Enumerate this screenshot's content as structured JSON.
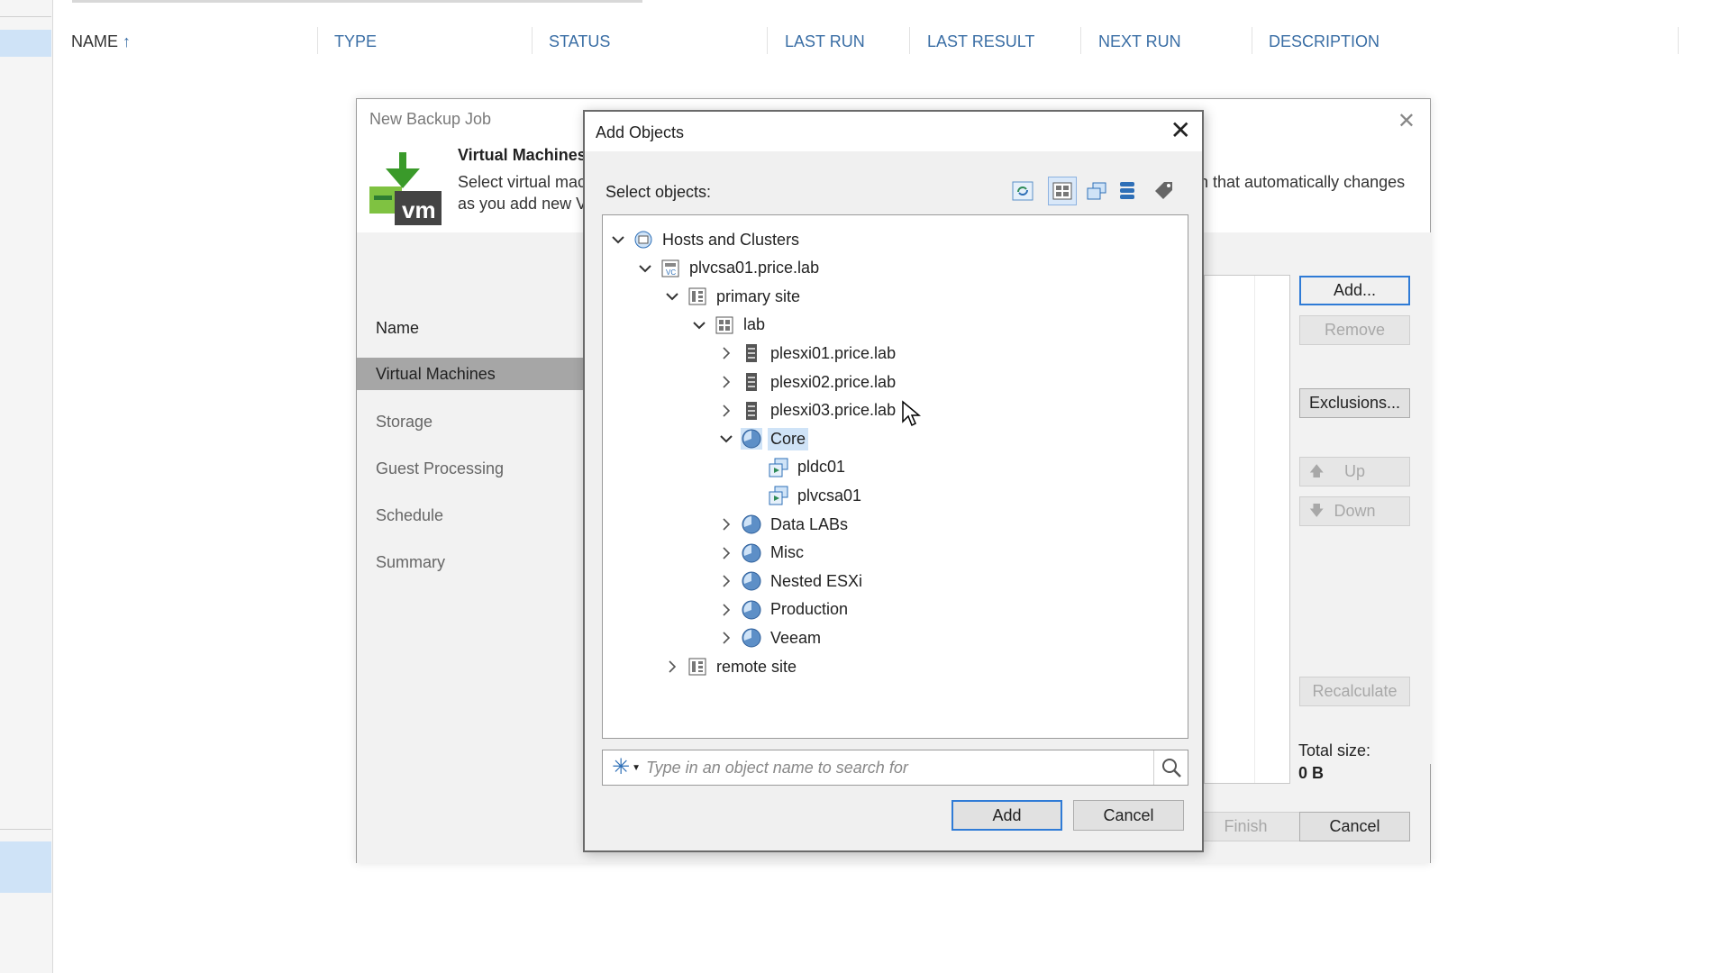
{
  "background": {
    "columns": [
      "NAME",
      "TYPE",
      "STATUS",
      "LAST RUN",
      "LAST RESULT",
      "NEXT RUN",
      "DESCRIPTION"
    ],
    "sort_indicator": "↑"
  },
  "wizard": {
    "title": "New Backup Job",
    "header_title": "Virtual Machines",
    "header_desc_line1": "Select virtual machines",
    "header_desc_line2": "as you add new VMs",
    "header_desc_right": "n that automatically changes",
    "nav": [
      "Name",
      "Virtual Machines",
      "Storage",
      "Guest Processing",
      "Schedule",
      "Summary"
    ],
    "active_step": "Virtual Machines",
    "buttons": {
      "add": "Add...",
      "remove": "Remove",
      "exclusions": "Exclusions...",
      "up": "Up",
      "down": "Down",
      "recalculate": "Recalculate",
      "finish": "Finish",
      "cancel": "Cancel"
    },
    "total_size_label": "Total size:",
    "total_size_value": "0 B",
    "accent_color": "#2f7bd6"
  },
  "dialog": {
    "title": "Add Objects",
    "select_label": "Select objects:",
    "toolbar_icons": [
      "refresh-icon",
      "hosts-and-clusters-view-icon",
      "vms-and-templates-view-icon",
      "datastores-view-icon",
      "tags-view-icon"
    ],
    "tree": [
      {
        "label": "Hosts and Clusters",
        "level": 0,
        "expanded": true,
        "icon": "hosts-clusters-icon"
      },
      {
        "label": "plvcsa01.price.lab",
        "level": 1,
        "expanded": true,
        "icon": "vcenter-icon"
      },
      {
        "label": "primary site",
        "level": 2,
        "expanded": true,
        "icon": "datacenter-icon"
      },
      {
        "label": "lab",
        "level": 3,
        "expanded": true,
        "icon": "cluster-icon"
      },
      {
        "label": "plesxi01.price.lab",
        "level": 4,
        "expanded": false,
        "icon": "host-icon"
      },
      {
        "label": "plesxi02.price.lab",
        "level": 4,
        "expanded": false,
        "icon": "host-icon"
      },
      {
        "label": "plesxi03.price.lab",
        "level": 4,
        "expanded": false,
        "icon": "host-icon"
      },
      {
        "label": "Core",
        "level": 4,
        "expanded": true,
        "icon": "resource-pool-icon",
        "selected": true
      },
      {
        "label": "pldc01",
        "level": 5,
        "leaf": true,
        "icon": "vm-icon"
      },
      {
        "label": "plvcsa01",
        "level": 5,
        "leaf": true,
        "icon": "vm-icon"
      },
      {
        "label": "Data LABs",
        "level": 4,
        "expanded": false,
        "icon": "resource-pool-icon"
      },
      {
        "label": "Misc",
        "level": 4,
        "expanded": false,
        "icon": "resource-pool-icon"
      },
      {
        "label": "Nested ESXi",
        "level": 4,
        "expanded": false,
        "icon": "resource-pool-icon"
      },
      {
        "label": "Production",
        "level": 4,
        "expanded": false,
        "icon": "resource-pool-icon"
      },
      {
        "label": "Veeam",
        "level": 4,
        "expanded": false,
        "icon": "resource-pool-icon"
      },
      {
        "label": "remote site",
        "level": 2,
        "expanded": false,
        "icon": "datacenter-icon"
      }
    ],
    "search_placeholder": "Type in an object name to search for",
    "add_button": "Add",
    "cancel_button": "Cancel"
  }
}
